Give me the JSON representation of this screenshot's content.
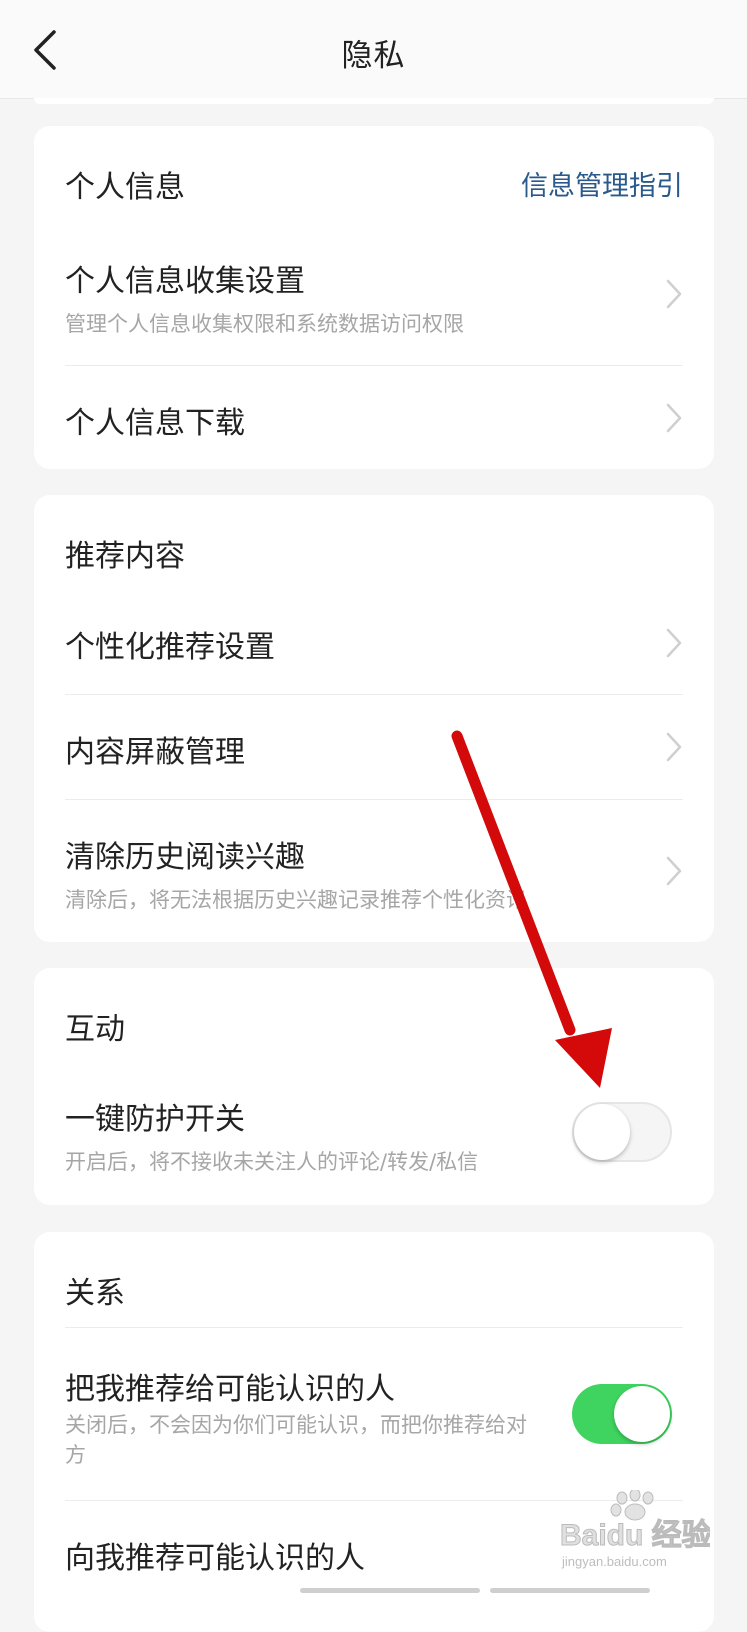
{
  "header": {
    "title": "隐私",
    "back_icon": "chevron-left-icon"
  },
  "sections": {
    "personal": {
      "title": "个人信息",
      "link": "信息管理指引",
      "items": [
        {
          "title": "个人信息收集设置",
          "subtitle": "管理个人信息收集权限和系统数据访问权限"
        },
        {
          "title": "个人信息下载"
        }
      ]
    },
    "recommend": {
      "title": "推荐内容",
      "items": [
        {
          "title": "个性化推荐设置"
        },
        {
          "title": "内容屏蔽管理"
        },
        {
          "title": "清除历史阅读兴趣",
          "subtitle": "清除后，将无法根据历史兴趣记录推荐个性化资讯"
        }
      ]
    },
    "interaction": {
      "title": "互动",
      "items": [
        {
          "title": "一键防护开关",
          "subtitle": "开启后，将不接收未关注人的评论/转发/私信",
          "toggle": false
        }
      ]
    },
    "relation": {
      "title": "关系",
      "items": [
        {
          "title": "把我推荐给可能认识的人",
          "subtitle": "关闭后，不会因为你们可能认识，而把你推荐给对方",
          "toggle": true
        },
        {
          "title": "向我推荐可能认识的人"
        }
      ]
    }
  },
  "colors": {
    "accent_link": "#2a5a8c",
    "toggle_on": "#3ed45f",
    "annotation_arrow": "#d40a0a"
  },
  "watermark": {
    "text": "Bai du 经验",
    "subtext": "jingyan.baidu.com"
  }
}
